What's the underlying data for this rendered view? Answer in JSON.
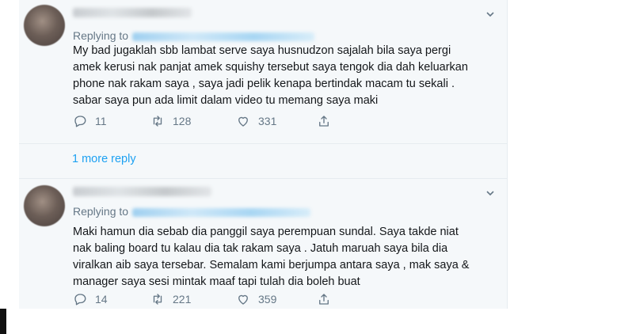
{
  "tweets": [
    {
      "replying_label": "Replying to",
      "text_lines": [
        "My bad jugaklah sbb lambat serve saya husnudzon sajalah bila saya pergi",
        "amek kerusi nak panjat amek squishy tersebut saya tengok dia dah keluarkan",
        "phone nak rakam saya , saya jadi pelik kenapa bertindak macam tu sekali .",
        "sabar saya pun ada limit dalam video tu memang saya maki"
      ],
      "replies": "11",
      "retweets": "128",
      "likes": "331"
    },
    {
      "replying_label": "Replying to",
      "text_lines": [
        "Maki hamun dia sebab dia panggil saya perempuan sundal. Saya takde niat",
        "nak baling board tu kalau dia tak rakam saya . Jatuh maruah saya bila dia",
        "viralkan aib saya tersebar. Semalam kami berjumpa antara saya , mak saya &",
        "manager saya sesi mintak maaf tapi tulah dia boleh buat"
      ],
      "replies": "14",
      "retweets": "221",
      "likes": "359"
    }
  ],
  "more_reply_label": "1 more reply",
  "colors": {
    "link": "#1da1f2",
    "muted": "#657786",
    "panel_bg": "#f5f8fa"
  },
  "icons": [
    "reply-icon",
    "retweet-icon",
    "like-icon",
    "share-icon",
    "chevron-down-icon"
  ]
}
